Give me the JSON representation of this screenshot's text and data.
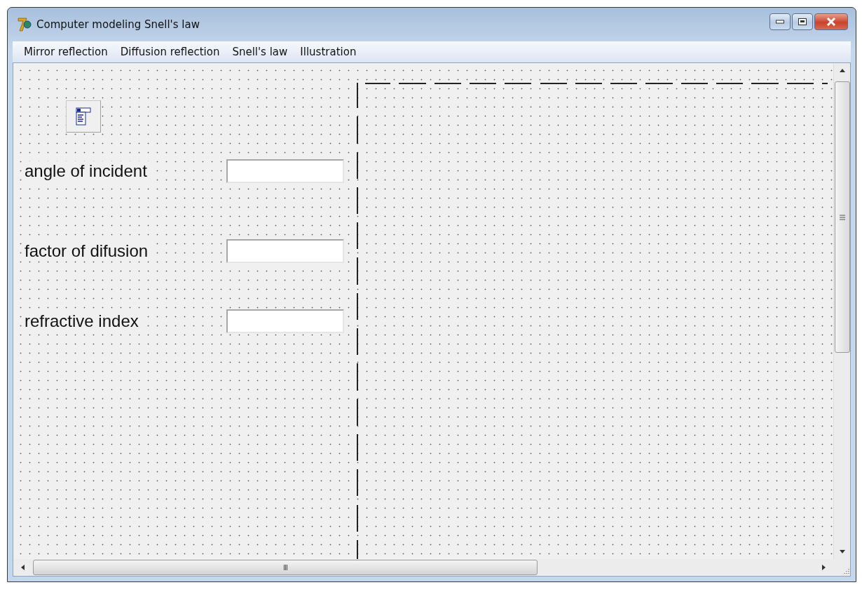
{
  "window": {
    "title": "Computer modeling Snell's law"
  },
  "menu": [
    {
      "label": "Mirror reflection"
    },
    {
      "label": "Diffusion reflection"
    },
    {
      "label": "Snell's law"
    },
    {
      "label": "Illustration"
    }
  ],
  "fields": [
    {
      "label": "angle of incident"
    },
    {
      "label": "factor of difusion"
    },
    {
      "label": "refractive index"
    }
  ],
  "scroll_glyph": "III"
}
